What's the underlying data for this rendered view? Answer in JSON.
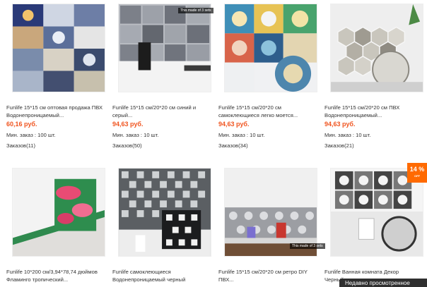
{
  "products": [
    {
      "title": "Funlife 15*15 см оптовая продажа ПВХ Водонепроницаемый...",
      "price": "60,16 руб.",
      "min_order": "Мин. заказ : 100 шт.",
      "orders": "Заказов(11)"
    },
    {
      "title": "Funlife 15*15 см/20*20 см синий и серый...",
      "price": "94,63 руб.",
      "min_order": "Мин. заказ : 10 шт.",
      "orders": "Заказов(50)",
      "image_badge": "This made of 3 sets"
    },
    {
      "title": "Funlife 15*15 см/20*20 см самоклеющиеся легко моется...",
      "price": "94,63 руб.",
      "min_order": "Мин. заказ : 10 шт.",
      "orders": "Заказов(34)"
    },
    {
      "title": "Funlife 15*15 см/20*20 см ПВХ Водонепроницаемый...",
      "price": "94,63 руб.",
      "min_order": "Мин. заказ : 10 шт.",
      "orders": "Заказов(21)"
    },
    {
      "title": "Funlife 10*200 см/3,94*78,74 дюймов Фламинго тропический..."
    },
    {
      "title": "Funlife самоклеющиеся Водонепроницаемый черный"
    },
    {
      "title": "Funlife 15*15 см/20*20 см ретро DIY ПВХ...",
      "image_badge": "This made of 3 sets"
    },
    {
      "title": "Funlife Ванная комната Декор Черный..."
    }
  ],
  "discount_badge": {
    "value": "14 %",
    "label": "OFF"
  },
  "recently_viewed": "Недавно просмотренное",
  "colors": {
    "price": "#f0541f",
    "discount": "#ff6a00"
  }
}
